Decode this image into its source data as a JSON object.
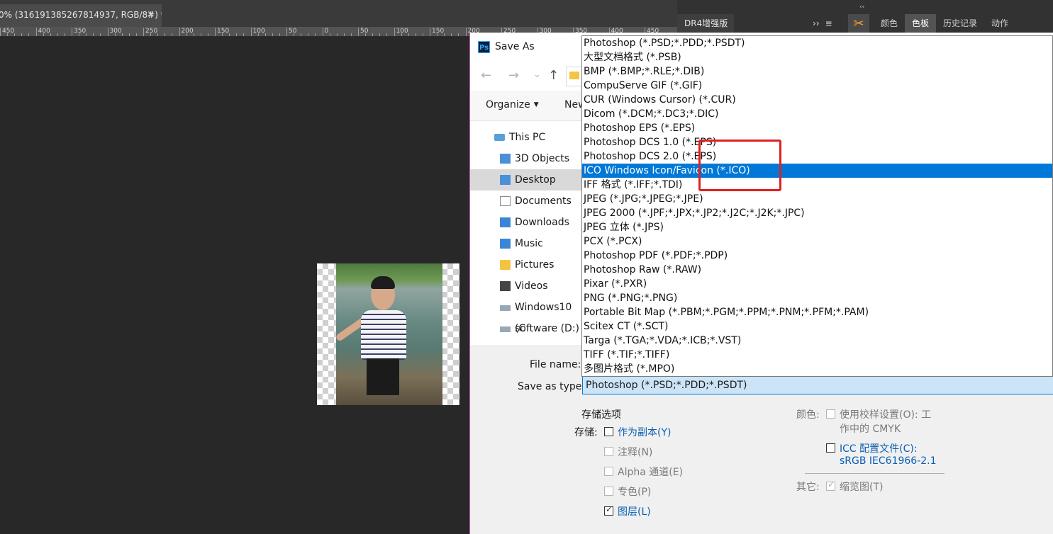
{
  "document_tab": {
    "title": "0% (316191385267814937, RGB/8#) *",
    "close": "×"
  },
  "ruler_labels": [
    "450",
    "400",
    "350",
    "300",
    "250",
    "200",
    "150",
    "100",
    "50",
    "0",
    "50",
    "100",
    "150",
    "200",
    "250",
    "300",
    "350",
    "400",
    "450",
    "500"
  ],
  "right_panel": {
    "collapse": "‹‹",
    "panel_name": "DR4增强版",
    "expand": "››",
    "menu": "≡",
    "tabs": [
      "颜色",
      "色板",
      "历史记录",
      "动作"
    ],
    "active_tab": "色板"
  },
  "dialog": {
    "title": "Save As",
    "nav": {
      "back": "←",
      "forward": "→",
      "recent": "⌄",
      "up": "↑"
    },
    "toolbar": {
      "organize": "Organize",
      "new_folder": "New"
    },
    "tree": [
      {
        "label": "This PC",
        "icon": "pc-icon"
      },
      {
        "label": "3D Objects",
        "icon": "3d-objects-icon"
      },
      {
        "label": "Desktop",
        "icon": "desktop-folder-icon",
        "selected": true
      },
      {
        "label": "Documents",
        "icon": "documents-icon"
      },
      {
        "label": "Downloads",
        "icon": "downloads-icon"
      },
      {
        "label": "Music",
        "icon": "music-icon"
      },
      {
        "label": "Pictures",
        "icon": "pictures-icon"
      },
      {
        "label": "Videos",
        "icon": "videos-icon"
      },
      {
        "label": "Windows10 (C",
        "icon": "windows-drive-icon"
      },
      {
        "label": "software (D:)",
        "icon": "drive-icon"
      }
    ],
    "file_name_label": "File name:",
    "save_type_label": "Save as type:",
    "save_type_value": "Photoshop (*.PSD;*.PDD;*.PSDT)",
    "file_types": [
      "Photoshop (*.PSD;*.PDD;*.PSDT)",
      "大型文档格式 (*.PSB)",
      "BMP (*.BMP;*.RLE;*.DIB)",
      "CompuServe GIF (*.GIF)",
      "CUR (Windows Cursor) (*.CUR)",
      "Dicom (*.DCM;*.DC3;*.DIC)",
      "Photoshop EPS (*.EPS)",
      "Photoshop DCS 1.0 (*.EPS)",
      "Photoshop DCS 2.0 (*.EPS)",
      "ICO Windows Icon/Favicon (*.ICO)",
      "IFF 格式 (*.IFF;*.TDI)",
      "JPEG (*.JPG;*.JPEG;*.JPE)",
      "JPEG 2000 (*.JPF;*.JPX;*.JP2;*.J2C;*.J2K;*.JPC)",
      "JPEG 立体 (*.JPS)",
      "PCX (*.PCX)",
      "Photoshop PDF (*.PDF;*.PDP)",
      "Photoshop Raw (*.RAW)",
      "Pixar (*.PXR)",
      "PNG (*.PNG;*.PNG)",
      "Portable Bit Map (*.PBM;*.PGM;*.PPM;*.PNM;*.PFM;*.PAM)",
      "Scitex CT (*.SCT)",
      "Targa (*.TGA;*.VDA;*.ICB;*.VST)",
      "TIFF (*.TIF;*.TIFF)",
      "多图片格式 (*.MPO)"
    ],
    "highlighted_type": "ICO Windows Icon/Favicon (*.ICO)",
    "options": {
      "heading": "存储选项",
      "save_label": "存储:",
      "as_copy": "作为副本(Y)",
      "annotations": "注释(N)",
      "alpha": "Alpha 通道(E)",
      "spot": "专色(P)",
      "layers": "图层(L)",
      "color_label": "颜色:",
      "proof_setup_1": "使用校样设置(O):  工",
      "proof_setup_2": "作中的 CMYK",
      "icc_1": "ICC 配置文件(C):",
      "icc_2": "sRGB IEC61966-2.1",
      "other_label": "其它:",
      "thumbnail": "缩览图(T)"
    }
  },
  "colors": {
    "highlight": "#0078d7",
    "annotation_box": "#e02020",
    "link_blue": "#0a5fb4"
  }
}
